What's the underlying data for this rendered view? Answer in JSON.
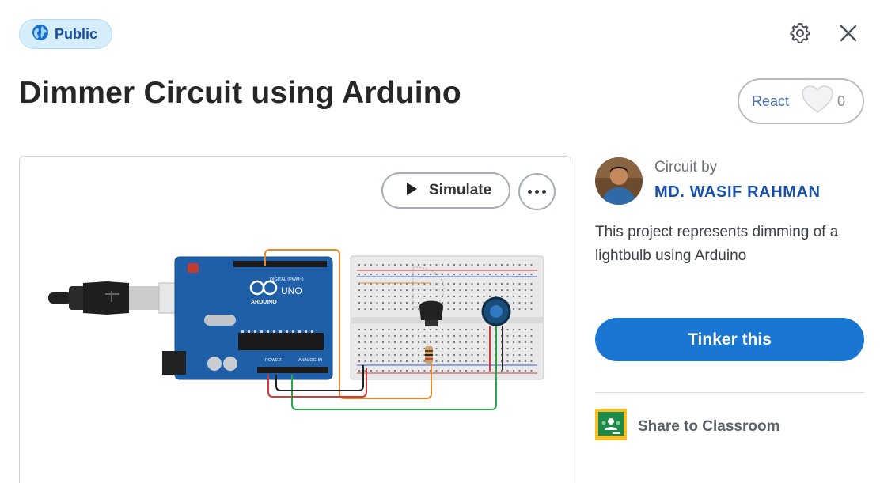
{
  "visibility": {
    "label": "Public",
    "icon": "globe-icon"
  },
  "header": {
    "settings_icon": "gear-icon",
    "close_icon": "close-icon"
  },
  "project": {
    "title": "Dimmer Circuit using Arduino",
    "description": "This project represents dimming of a lightbulb using Arduino"
  },
  "reactions": {
    "label": "React",
    "icon": "heart-icon",
    "count": "0"
  },
  "preview": {
    "simulate_label": "Simulate",
    "simulate_icon": "play-icon",
    "more_icon": "more-horizontal-icon",
    "board_labels": {
      "brand": "ARDUINO",
      "model": "UNO",
      "digital": "DIGITAL (PWM~)",
      "power": "POWER",
      "analog": "ANALOG IN"
    }
  },
  "author": {
    "prefix": "Circuit by",
    "name": "MD. WASIF RAHMAN"
  },
  "actions": {
    "tinker_label": "Tinker this",
    "share_label": "Share to Classroom",
    "share_icon": "google-classroom-icon"
  },
  "colors": {
    "primary": "#1977d2",
    "author_link": "#1850a8",
    "badge_bg": "#d6eefb",
    "arduino_board": "#1f5fa8"
  }
}
